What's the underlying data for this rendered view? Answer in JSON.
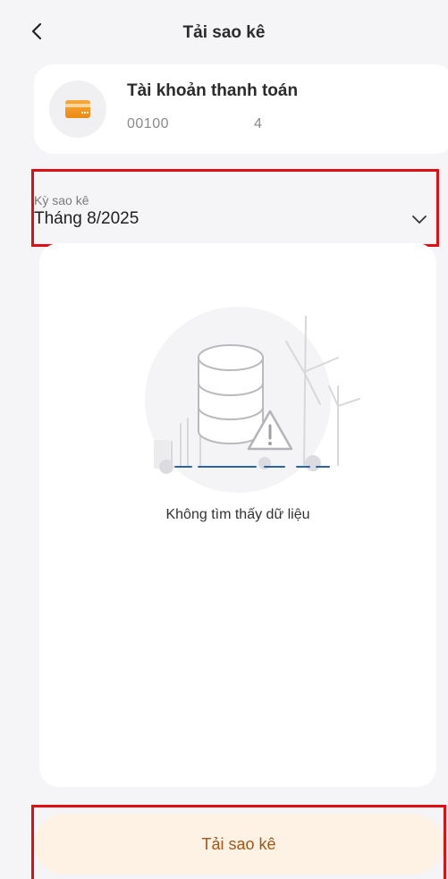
{
  "header": {
    "title": "Tải sao kê",
    "back_icon": "chevron-left-icon"
  },
  "account": {
    "icon": "card-icon",
    "name": "Tài khoản thanh toán",
    "number_prefix": "00100",
    "number_suffix": "4"
  },
  "period": {
    "label": "Kỳ sao kê",
    "value": "Tháng 8/2025",
    "chevron_icon": "chevron-down-icon"
  },
  "empty_state": {
    "illustration": "no-data-database-warning-illustration",
    "message": "Không tìm thấy dữ liệu"
  },
  "actions": {
    "download_label": "Tải sao kê"
  },
  "colors": {
    "accent_text": "#a4561a",
    "accent_bg": "#fdf2e3",
    "card_icon": "#f39a1e",
    "highlight": "#e10f14",
    "page_bg": "#f5f5f7"
  }
}
